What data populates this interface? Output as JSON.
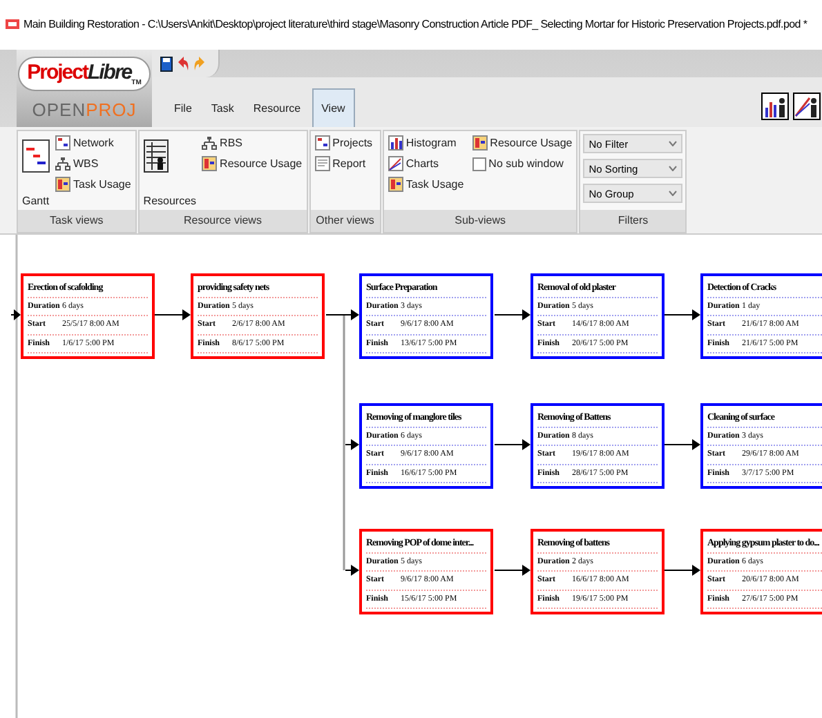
{
  "window": {
    "title": "Main Building Restoration - C:\\Users\\Ankit\\Desktop\\project literature\\third stage\\Masonry Construction Article PDF_ Selecting Mortar for Historic Preservation Projects.pdf.pod *"
  },
  "logo": {
    "brand": "Project",
    "brand_italic": "Libre",
    "tm": "TM",
    "sub_a": "OPEN",
    "sub_b": "PROJ"
  },
  "tabs": [
    {
      "label": "File",
      "selected": false
    },
    {
      "label": "Task",
      "selected": false
    },
    {
      "label": "Resource",
      "selected": false
    },
    {
      "label": "View",
      "selected": true
    }
  ],
  "ribbon_groups": [
    {
      "title": "Task views",
      "large": {
        "label": "Gantt"
      },
      "items": [
        {
          "label": "Network",
          "kind": "button"
        },
        {
          "label": "WBS",
          "kind": "button"
        },
        {
          "label": "Task Usage",
          "kind": "button"
        }
      ]
    },
    {
      "title": "Resource views",
      "large": {
        "label": "Resources"
      },
      "items": [
        {
          "label": "RBS",
          "kind": "button"
        },
        {
          "label": "Resource Usage",
          "kind": "button"
        }
      ]
    },
    {
      "title": "Other views",
      "items": [
        {
          "label": "Projects",
          "kind": "button"
        },
        {
          "label": "Report",
          "kind": "button"
        }
      ]
    },
    {
      "title": "Sub-views",
      "items": [
        {
          "label": "Histogram",
          "kind": "button"
        },
        {
          "label": "Resource Usage",
          "kind": "button"
        },
        {
          "label": "Charts",
          "kind": "button"
        },
        {
          "label": "No sub window",
          "kind": "checkbox",
          "checked": false
        },
        {
          "label": "Task Usage",
          "kind": "button"
        }
      ]
    },
    {
      "title": "Filters",
      "items": [
        {
          "label": "No Filter",
          "kind": "dropdown"
        },
        {
          "label": "No Sorting",
          "kind": "dropdown"
        },
        {
          "label": "No Group",
          "kind": "dropdown"
        }
      ]
    }
  ],
  "nodes": [
    {
      "name": "Erection of scafolding",
      "critical": true,
      "fields": [
        {
          "label": "Duration",
          "value": "6 days"
        },
        {
          "label": "Start",
          "value": "25/5/17 8:00 AM"
        },
        {
          "label": "Finish",
          "value": "1/6/17 5:00 PM"
        }
      ]
    },
    {
      "name": "providing safety nets",
      "critical": true,
      "fields": [
        {
          "label": "Duration",
          "value": "5 days"
        },
        {
          "label": "Start",
          "value": "2/6/17 8:00 AM"
        },
        {
          "label": "Finish",
          "value": "8/6/17 5:00 PM"
        }
      ]
    },
    {
      "name": "Surface Preparation",
      "critical": false,
      "fields": [
        {
          "label": "Duration",
          "value": "3 days"
        },
        {
          "label": "Start",
          "value": "9/6/17 8:00 AM"
        },
        {
          "label": "Finish",
          "value": "13/6/17 5:00 PM"
        }
      ]
    },
    {
      "name": "Removal of old plaster",
      "critical": false,
      "fields": [
        {
          "label": "Duration",
          "value": "5 days"
        },
        {
          "label": "Start",
          "value": "14/6/17 8:00 AM"
        },
        {
          "label": "Finish",
          "value": "20/6/17 5:00 PM"
        }
      ]
    },
    {
      "name": "Detection of Cracks",
      "critical": false,
      "fields": [
        {
          "label": "Duration",
          "value": "1 day"
        },
        {
          "label": "Start",
          "value": "21/6/17 8:00 AM"
        },
        {
          "label": "Finish",
          "value": "21/6/17 5:00 PM"
        }
      ]
    },
    {
      "name": "Removing of manglore tiles",
      "critical": false,
      "fields": [
        {
          "label": "Duration",
          "value": "6 days"
        },
        {
          "label": "Start",
          "value": "9/6/17 8:00 AM"
        },
        {
          "label": "Finish",
          "value": "16/6/17 5:00 PM"
        }
      ]
    },
    {
      "name": "Removing of Battens",
      "critical": false,
      "fields": [
        {
          "label": "Duration",
          "value": "8 days"
        },
        {
          "label": "Start",
          "value": "19/6/17 8:00 AM"
        },
        {
          "label": "Finish",
          "value": "28/6/17 5:00 PM"
        }
      ]
    },
    {
      "name": "Cleaning of surface",
      "critical": false,
      "fields": [
        {
          "label": "Duration",
          "value": "3 days"
        },
        {
          "label": "Start",
          "value": "29/6/17 8:00 AM"
        },
        {
          "label": "Finish",
          "value": "3/7/17 5:00 PM"
        }
      ]
    },
    {
      "name": "Removing POP of dome inter...",
      "critical": true,
      "fields": [
        {
          "label": "Duration",
          "value": "5 days"
        },
        {
          "label": "Start",
          "value": "9/6/17 8:00 AM"
        },
        {
          "label": "Finish",
          "value": "15/6/17 5:00 PM"
        }
      ]
    },
    {
      "name": "Removing of battens",
      "critical": true,
      "fields": [
        {
          "label": "Duration",
          "value": "2 days"
        },
        {
          "label": "Start",
          "value": "16/6/17 8:00 AM"
        },
        {
          "label": "Finish",
          "value": "19/6/17 5:00 PM"
        }
      ]
    },
    {
      "name": "Applying gypsum plaster to do...",
      "critical": true,
      "fields": [
        {
          "label": "Duration",
          "value": "6 days"
        },
        {
          "label": "Start",
          "value": "20/6/17 8:00 AM"
        },
        {
          "label": "Finish",
          "value": "27/6/17 5:00 PM"
        }
      ]
    }
  ]
}
